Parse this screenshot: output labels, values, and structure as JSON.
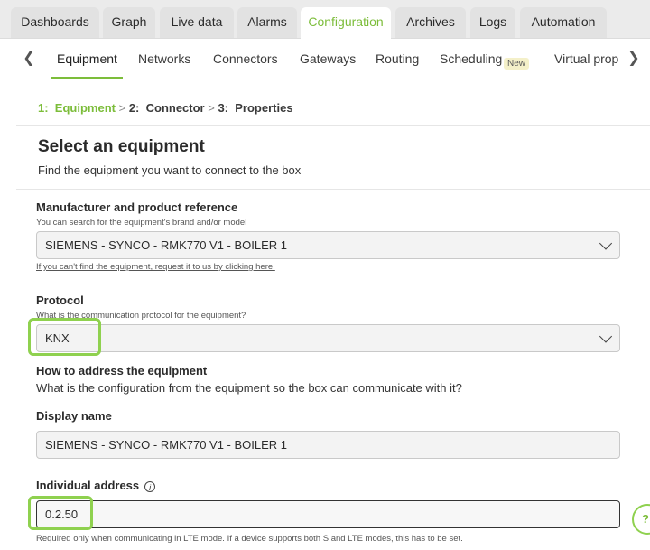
{
  "tabs": [
    {
      "label": "Dashboards"
    },
    {
      "label": "Graph"
    },
    {
      "label": "Live data"
    },
    {
      "label": "Alarms"
    },
    {
      "label": "Configuration",
      "active": true
    },
    {
      "label": "Archives"
    },
    {
      "label": "Logs"
    },
    {
      "label": "Automation"
    }
  ],
  "subnav": {
    "items": [
      "Equipment",
      "Networks",
      "Connectors",
      "Gateways",
      "Routing",
      "Scheduling",
      "Virtual prop"
    ],
    "new_badge": "New",
    "active": "Equipment"
  },
  "stepper": {
    "step1_num": "1:",
    "step1": "Equipment",
    "sep": ">",
    "step2_num": "2:",
    "step2": "Connector",
    "step3_num": "3:",
    "step3": "Properties"
  },
  "page": {
    "title": "Select an equipment",
    "subtitle": "Find the equipment you want to connect to the box"
  },
  "manufacturer": {
    "label": "Manufacturer and product reference",
    "hint": "You can search for the equipment's brand and/or model",
    "value": "SIEMENS - SYNCO - RMK770 V1 - BOILER 1",
    "link": "If you can't find the equipment, request it to us by clicking here!"
  },
  "protocol": {
    "label": "Protocol",
    "hint": "What is the communication protocol for the equipment?",
    "value": "KNX"
  },
  "addressing": {
    "label": "How to address the equipment",
    "text": "What is the configuration from the equipment so the box can communicate with it?"
  },
  "display_name": {
    "label": "Display name",
    "value": "SIEMENS - SYNCO - RMK770 V1 - BOILER 1"
  },
  "individual_address": {
    "label": "Individual address",
    "info_glyph": "i",
    "value": "0.2.50",
    "hint": "Required only when communicating in LTE mode. If a device supports both S and LTE modes, this has to be set."
  },
  "colors": {
    "accent": "#7cbd3a",
    "highlight": "#8fd14f"
  }
}
